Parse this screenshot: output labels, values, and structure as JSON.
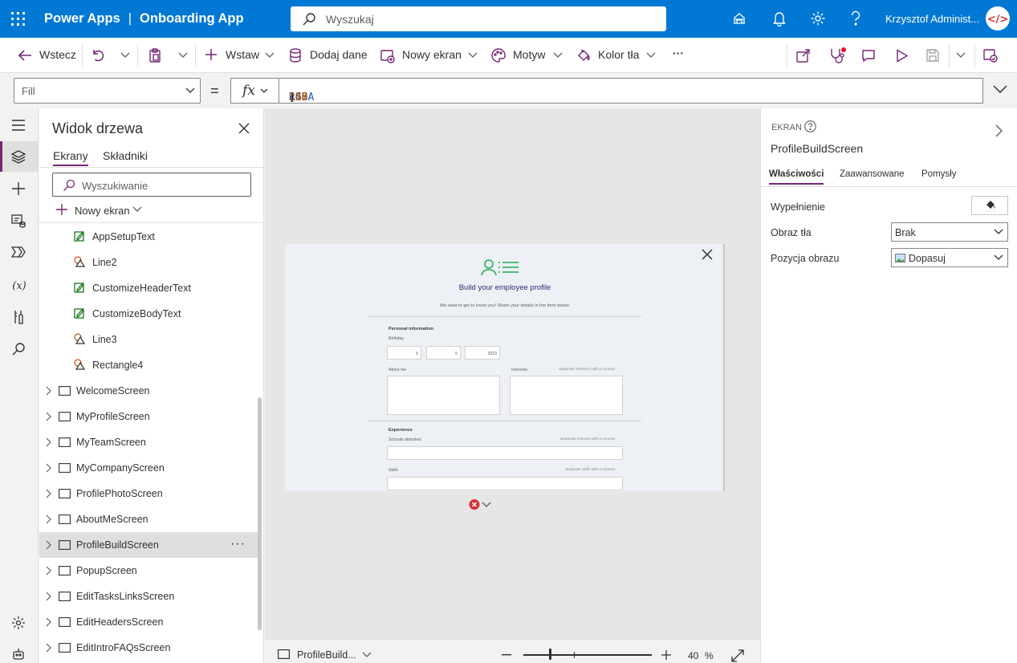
{
  "titlebar": {
    "product": "Power Apps",
    "separator": "|",
    "app_name": "Onboarding App",
    "search_placeholder": "Wyszukaj",
    "user": "Krzysztof Administ..."
  },
  "commandbar": {
    "back": "Wstecz",
    "insert": "Wstaw",
    "add_data": "Dodaj dane",
    "new_screen": "Nowy ekran",
    "theme": "Motyw",
    "background_color": "Kolor tła",
    "more": "···"
  },
  "formulabar": {
    "property": "Fill",
    "equals": "=",
    "fx": "fx",
    "formula": {
      "fn": "RGBA",
      "open": "(",
      "r": "237",
      "g": "240",
      "b": "245",
      "a": "1",
      "sep": "; ",
      "close": ")"
    }
  },
  "tree": {
    "title": "Widok drzewa",
    "tabs": [
      "Ekrany",
      "Składniki"
    ],
    "search_placeholder": "Wyszukiwanie",
    "new_screen": "Nowy ekran",
    "children": [
      {
        "label": "AppSetupText",
        "icon": "text-icon"
      },
      {
        "label": "Line2",
        "icon": "shape-icon"
      },
      {
        "label": "CustomizeHeaderText",
        "icon": "text-icon"
      },
      {
        "label": "CustomizeBodyText",
        "icon": "text-icon"
      },
      {
        "label": "Line3",
        "icon": "shape-icon"
      },
      {
        "label": "Rectangle4",
        "icon": "shape-icon"
      }
    ],
    "screens": [
      "WelcomeScreen",
      "MyProfileScreen",
      "MyTeamScreen",
      "MyCompanyScreen",
      "ProfilePhotoScreen",
      "AboutMeScreen",
      "ProfileBuildScreen",
      "PopupScreen",
      "EditTasksLinksScreen",
      "EditHeadersScreen",
      "EditIntroFAQsScreen"
    ],
    "selected_screen": "ProfileBuildScreen",
    "more": "···"
  },
  "canvas": {
    "heading": "Build your employee profile",
    "subheading": "We want to get to know you! Share your details in the form below.",
    "personal_info": "Personal information",
    "birthday": "Birthday",
    "birthday_day": "5",
    "birthday_month": "5",
    "birthday_year": "2023",
    "about_me": "About me",
    "interests": "Interests",
    "interests_hint": "Separate interests with a comma",
    "experience": "Experience",
    "schools": "Schools attended",
    "schools_hint": "Separate schools with a comma",
    "skills": "Skills",
    "skills_hint": "Separate skills with a comma"
  },
  "statusbar": {
    "screen": "ProfileBuild...",
    "zoom": "40",
    "percent": "%",
    "zoom_fraction": 0.4
  },
  "props": {
    "kind": "EKRAN",
    "name": "ProfileBuildScreen",
    "tabs": [
      "Właściwości",
      "Zaawansowane",
      "Pomysły"
    ],
    "fill_label": "Wypełnienie",
    "bgimage_label": "Obraz tła",
    "bgimage_value": "Brak",
    "imgpos_label": "Pozycja obrazu",
    "imgpos_value": "Dopasuj"
  },
  "colors": {
    "brand": "#0078d4",
    "accent": "#742774",
    "canvas_fill": "#edf0f5",
    "profile_icon": "#3bb56a",
    "error": "#d13438"
  }
}
